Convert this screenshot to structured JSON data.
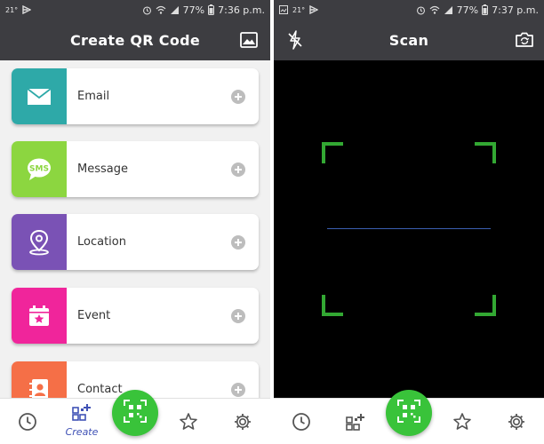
{
  "left": {
    "status": {
      "temp": "21°",
      "battery": "77%",
      "time": "7:36 p.m."
    },
    "appbar": {
      "title": "Create QR Code",
      "gallery_icon": "image-icon"
    },
    "items": [
      {
        "label": "Email",
        "icon": "envelope-icon",
        "color": "#2ea9a8"
      },
      {
        "label": "Message",
        "icon": "sms-bubble-icon",
        "color": "#8cd640"
      },
      {
        "label": "Location",
        "icon": "map-pin-icon",
        "color": "#7a52b5"
      },
      {
        "label": "Event",
        "icon": "calendar-star-icon",
        "color": "#f0259b"
      },
      {
        "label": "Contact",
        "icon": "contact-book-icon",
        "color": "#f56f47"
      }
    ],
    "nav": {
      "history_icon": "clock-icon",
      "create_label": "Create",
      "create_icon": "qr-plus-icon",
      "scan_icon": "qr-scan-icon",
      "favorites_icon": "star-icon",
      "settings_icon": "gear-icon"
    }
  },
  "right": {
    "status": {
      "temp": "21°",
      "battery": "77%",
      "time": "7:37 p.m."
    },
    "appbar": {
      "title": "Scan",
      "flash_icon": "flash-off-icon",
      "camera_icon": "camera-switch-icon"
    },
    "nav": {
      "history_icon": "clock-icon",
      "create_icon": "qr-plus-icon",
      "scan_icon": "qr-scan-icon",
      "favorites_icon": "star-icon",
      "settings_icon": "gear-icon"
    }
  },
  "colors": {
    "bar": "#3d3d41",
    "accent_green": "#39c33a",
    "create_blue": "#3f51b5",
    "scan_frame": "#33a833",
    "scan_line": "#3b5fb0"
  }
}
